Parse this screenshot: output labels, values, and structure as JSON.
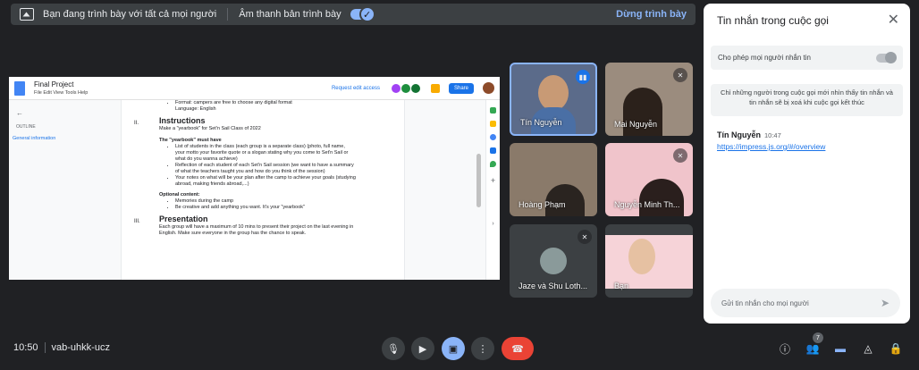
{
  "banner": {
    "presenting_text": "Bạn đang trình bày với tất cả mọi người",
    "audio_label": "Âm thanh bản trình bày",
    "stop_label": "Dừng trình bày",
    "toggle_icon": "check-icon"
  },
  "doc": {
    "title": "Final Project",
    "menu": "File  Edit  View  Tools  Help",
    "request_edit": "Request edit access",
    "share": "Share",
    "outline_label": "OUTLINE",
    "outline_item": "General information",
    "lines_top": [
      "Format: campers are free to choose any digital format",
      "Language: English"
    ],
    "sec2_num": "II.",
    "sec2_title": "Instructions",
    "sec2_intro": "Make a \"yearbook\" for Set'n Sail Class of 2022",
    "must_have": "The \"yearbook\" must have",
    "must_items": [
      "List of students in the class (each group is a separate class) (photo, full name, your motto your favorite quote or a slogan stating why you come to Set'n Sail or what do you wanna achieve)",
      "Reflection of each student of each Set'n Sail session (we want to have a summary of what the teachers taught you and how do you think of the session)",
      "Your notes on what will be your plan after the camp to achieve your goals (studying abroad, making friends abroad,...)"
    ],
    "optional": "Optional content:",
    "optional_items": [
      "Memories during the camp",
      "Be creative and add anything you want. It's your \"yearbook\""
    ],
    "sec3_num": "III.",
    "sec3_title": "Presentation",
    "sec3_text": "Each group will have a maximum of 10 mins to present their project on the last evening in English. Make sure everyone in the group has the chance to speak."
  },
  "tiles": [
    {
      "name": "Tín Nguyễn",
      "color": "#5b6b8a",
      "active": true
    },
    {
      "name": "Mai Nguyễn",
      "color": "#9b8c7e"
    },
    {
      "name": "Hoàng Phạm",
      "color": "#8a7a6a"
    },
    {
      "name": "Nguyễn Minh Th...",
      "color": "#e9c2c8"
    },
    {
      "name": "Jaze và Shu Loth...",
      "color": "#3c4043"
    },
    {
      "name": "Bạn",
      "color": "#f2c9d0"
    }
  ],
  "panel": {
    "title": "Tin nhắn trong cuộc gọi",
    "allow": "Cho phép mọi người nhắn tin",
    "info": "Chỉ những người trong cuộc gọi mới nhìn thấy tin nhắn và tin nhắn sẽ bị xoá khi cuộc gọi kết thúc",
    "sender": "Tín Nguyễn",
    "time": "10:47",
    "link": "https://impress.js.org/#/overview",
    "input_placeholder": "Gửi tin nhắn cho mọi người"
  },
  "bottom": {
    "time": "10:50",
    "code": "vab-uhkk-ucz",
    "people_count": "7"
  },
  "colors": {
    "accent": "#8ab4f8",
    "end_call": "#ea4335",
    "present": "#8ab4f8"
  }
}
